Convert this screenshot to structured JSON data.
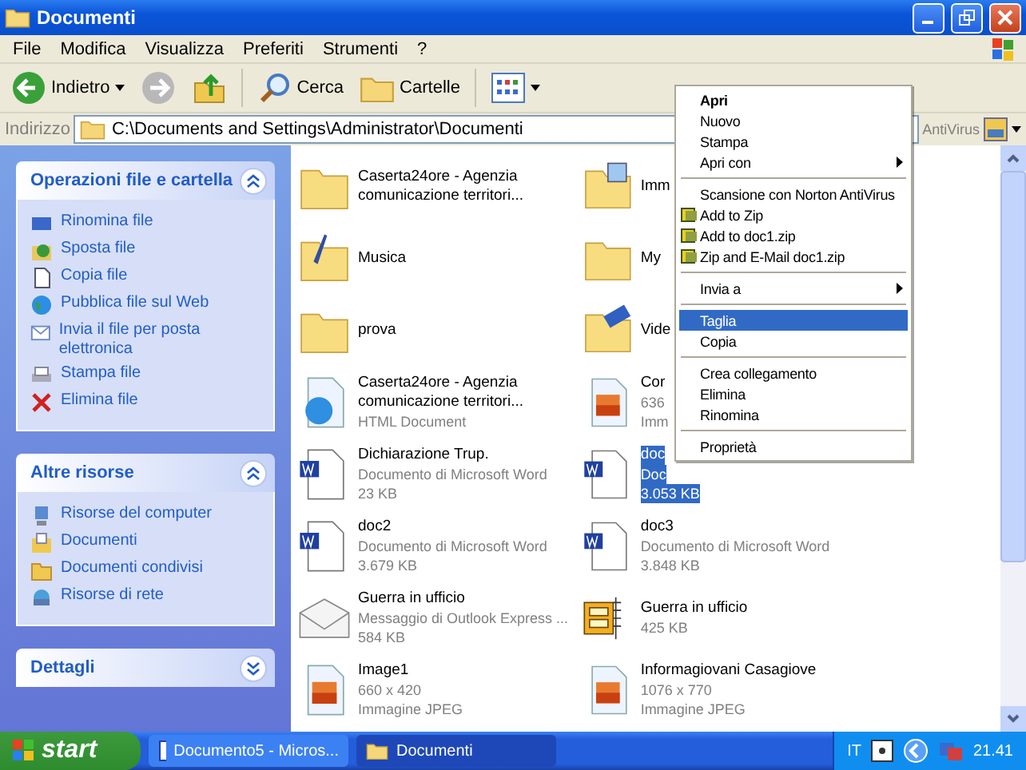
{
  "window": {
    "title": "Documenti"
  },
  "menu_bar": [
    "File",
    "Modifica",
    "Visualizza",
    "Preferiti",
    "Strumenti",
    "?"
  ],
  "toolbar": {
    "back": "Indietro",
    "search": "Cerca",
    "folders": "Cartelle"
  },
  "address_bar": {
    "label": "Indirizzo",
    "value": "C:\\Documents and Settings\\Administrator\\Documenti",
    "extra": "AntiVirus"
  },
  "sidebar": [
    {
      "title": "Operazioni file e cartella",
      "expanded": true,
      "items": [
        {
          "label": "Rinomina file",
          "kind": "rename"
        },
        {
          "label": "Sposta file",
          "kind": "move"
        },
        {
          "label": "Copia file",
          "kind": "copy"
        },
        {
          "label": "Pubblica file sul Web",
          "kind": "web"
        },
        {
          "label": "Invia il file per posta elettronica",
          "kind": "mail"
        },
        {
          "label": "Stampa file",
          "kind": "print"
        },
        {
          "label": "Elimina file",
          "kind": "delete"
        }
      ]
    },
    {
      "title": "Altre risorse",
      "expanded": true,
      "items": [
        {
          "label": "Risorse del computer",
          "kind": "computer"
        },
        {
          "label": "Documenti",
          "kind": "documents"
        },
        {
          "label": "Documenti condivisi",
          "kind": "folder"
        },
        {
          "label": "Risorse di rete",
          "kind": "network"
        }
      ]
    },
    {
      "title": "Dettagli",
      "expanded": false
    }
  ],
  "files": [
    {
      "name": "Caserta24ore - Agenzia comunicazione territori...",
      "kind": "folder",
      "selected": false
    },
    {
      "name": "Imm",
      "kind": "folder-pictures",
      "selected": false
    },
    {
      "name": "Musica",
      "kind": "folder-music",
      "selected": false
    },
    {
      "name": "My",
      "kind": "folder",
      "selected": false
    },
    {
      "name": "prova",
      "kind": "folder",
      "selected": false
    },
    {
      "name": "Vide",
      "kind": "folder-video",
      "selected": false
    },
    {
      "name": "Caserta24ore - Agenzia comunicazione territori...",
      "details": [
        "HTML Document"
      ],
      "kind": "html",
      "selected": false
    },
    {
      "name": "Cor",
      "details": [
        "636",
        "Imm"
      ],
      "kind": "image",
      "selected": false
    },
    {
      "name": "Dichiarazione Trup.",
      "details": [
        "Documento di Microsoft Word",
        "23 KB"
      ],
      "kind": "word",
      "selected": false
    },
    {
      "name": "doc",
      "details": [
        "Doc",
        "3.053 KB"
      ],
      "kind": "word",
      "selected": true
    },
    {
      "name": "doc2",
      "details": [
        "Documento di Microsoft Word",
        "3.679 KB"
      ],
      "kind": "word",
      "selected": false
    },
    {
      "name": "doc3",
      "details": [
        "Documento di Microsoft Word",
        "3.848 KB"
      ],
      "kind": "word",
      "selected": false
    },
    {
      "name": "Guerra in ufficio",
      "details": [
        "Messaggio di Outlook Express ...",
        "584 KB"
      ],
      "kind": "mail",
      "selected": false
    },
    {
      "name": "Guerra in ufficio",
      "details": [
        "425 KB"
      ],
      "kind": "zip",
      "selected": false
    },
    {
      "name": "Image1",
      "details": [
        "660 x 420",
        "Immagine JPEG"
      ],
      "kind": "image",
      "selected": false
    },
    {
      "name": "Informagiovani Casagiove",
      "details": [
        "1076 x 770",
        "Immagine JPEG"
      ],
      "kind": "image",
      "selected": false
    }
  ],
  "context_menu": [
    {
      "label": "Apri",
      "kind": "default",
      "selected": false
    },
    {
      "label": "Nuovo",
      "kind": "item",
      "selected": false
    },
    {
      "label": "Stampa",
      "kind": "item",
      "selected": false
    },
    {
      "label": "Apri con",
      "kind": "submenu",
      "selected": false
    },
    {
      "kind": "separator"
    },
    {
      "label": "Scansione con Norton AntiVirus",
      "kind": "item",
      "selected": false
    },
    {
      "label": "Add to Zip",
      "kind": "zip",
      "selected": false
    },
    {
      "label": "Add to doc1.zip",
      "kind": "zip",
      "selected": false
    },
    {
      "label": "Zip and E-Mail doc1.zip",
      "kind": "zip",
      "selected": false
    },
    {
      "kind": "separator"
    },
    {
      "label": "Invia a",
      "kind": "submenu",
      "selected": false
    },
    {
      "kind": "separator"
    },
    {
      "label": "Taglia",
      "kind": "item",
      "selected": true
    },
    {
      "label": "Copia",
      "kind": "item",
      "selected": false
    },
    {
      "kind": "separator"
    },
    {
      "label": "Crea collegamento",
      "kind": "item",
      "selected": false
    },
    {
      "label": "Elimina",
      "kind": "item",
      "selected": false
    },
    {
      "label": "Rinomina",
      "kind": "item",
      "selected": false
    },
    {
      "kind": "separator"
    },
    {
      "label": "Proprietà",
      "kind": "item",
      "selected": false
    }
  ],
  "taskbar": {
    "start": "start",
    "tasks": [
      {
        "label": "Documento5 - Micros...",
        "kind": "word",
        "selected": false
      },
      {
        "label": "Documenti",
        "kind": "folder",
        "selected": true
      }
    ],
    "language": "IT",
    "clock": "21.41"
  }
}
